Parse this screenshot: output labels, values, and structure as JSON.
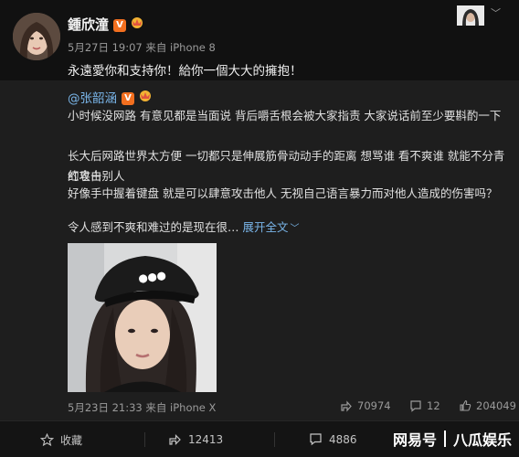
{
  "post": {
    "author": "鍾欣潼",
    "meta": "5月27日 19:07 来自 iPhone 8",
    "text": "永遠愛你和支持你！給你一個大大的擁抱！"
  },
  "repost": {
    "author": "@张韶涵",
    "paragraphs": [
      "小时候没网路 有意见都是当面说 背后嚼舌根会被大家指责 大家说话前至少要斟酌一下",
      "长大后网路世界太方便 一切都只是伸展筋骨动动手的距离 想骂谁 看不爽谁 就能不分青红皂白",
      "的攻击别人",
      "好像手中握着键盘 就是可以肆意攻击他人 无视自己语言暴力而对他人造成的伤害吗？",
      "令人感到不爽和难过的是现在很…"
    ],
    "expand_label": "展开全文",
    "expand_arrow": "﹀",
    "meta": "5月23日 21:33 来自 iPhone X",
    "stats": {
      "reposts": "70974",
      "comments": "12",
      "likes": "204049"
    }
  },
  "actions": {
    "favorite": "收藏",
    "repost": "12413",
    "comment": "4886"
  },
  "watermark": {
    "left": "网易号",
    "right": "八瓜娱乐"
  },
  "colors": {
    "link": "#7ab6ea",
    "verified": "#f36f1f",
    "background": "#111111",
    "card": "#1e1e1e"
  }
}
